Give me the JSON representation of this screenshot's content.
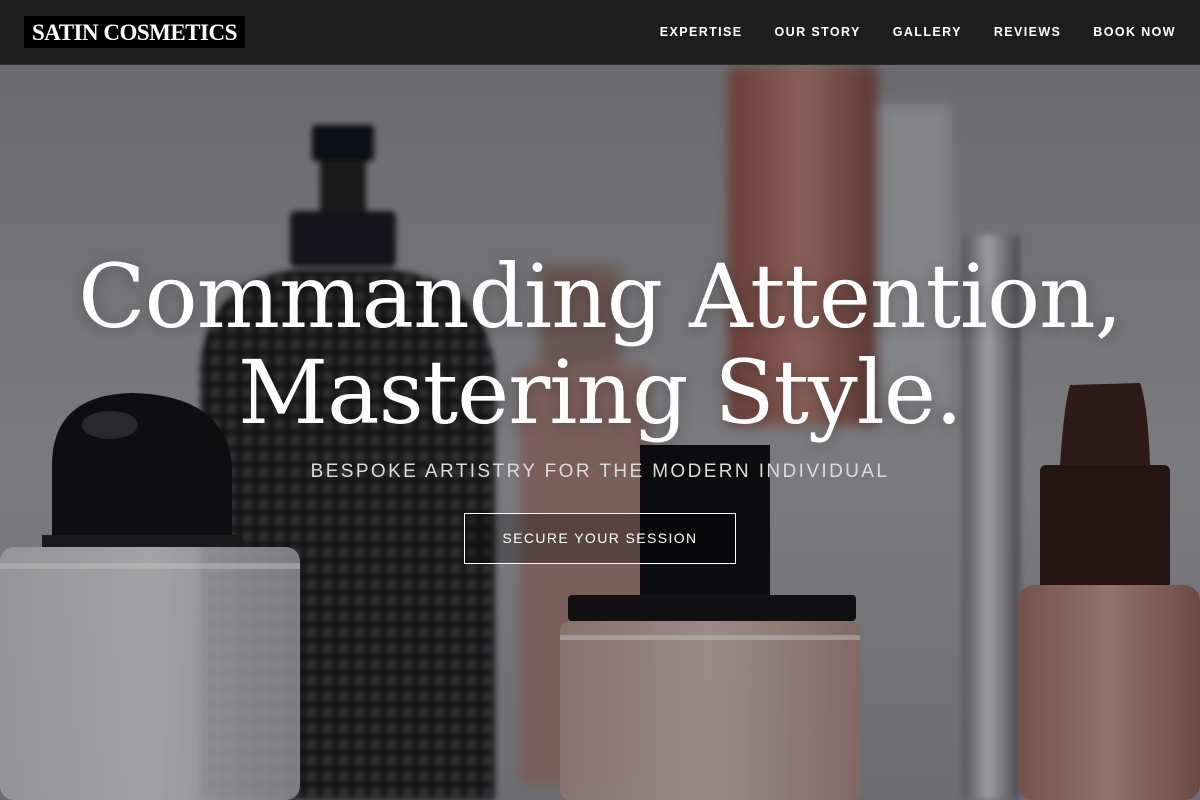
{
  "brand": {
    "name": "SATIN COSMETICS"
  },
  "nav": {
    "items": [
      {
        "label": "EXPERTISE"
      },
      {
        "label": "OUR STORY"
      },
      {
        "label": "GALLERY"
      },
      {
        "label": "REVIEWS"
      },
      {
        "label": "BOOK NOW"
      }
    ]
  },
  "hero": {
    "title_line1": "Commanding Attention,",
    "title_line2": "Mastering Style.",
    "subtitle": "BESPOKE ARTISTRY FOR THE MODERN INDIVIDUAL",
    "cta_label": "SECURE YOUR SESSION"
  },
  "colors": {
    "navbar_bg": "#1e1e1e",
    "brand_bg": "#000000",
    "text_primary": "#ffffff",
    "subtitle_text": "#dcdcdc"
  }
}
